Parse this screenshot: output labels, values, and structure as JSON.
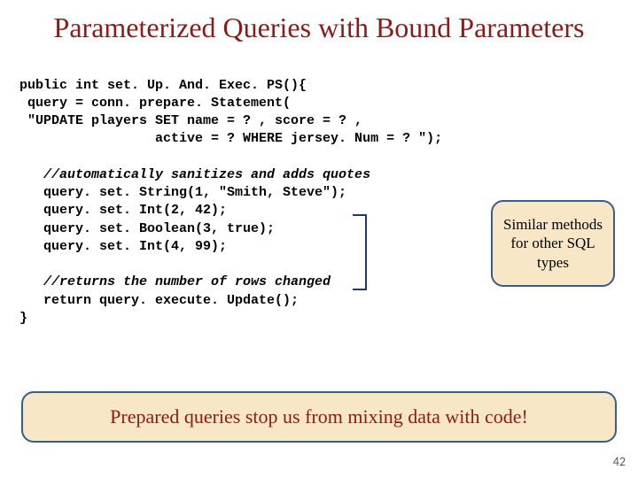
{
  "title": "Parameterized Queries with Bound Parameters",
  "code": {
    "l1": "public int set. Up. And. Exec. PS(){",
    "l2": " query = conn. prepare. Statement(",
    "l3": " \"UPDATE players SET name = ? , score = ? ,",
    "l4": "                 active = ? WHERE jersey. Num = ? \");",
    "l5": "",
    "c1": "   //automatically sanitizes and adds quotes",
    "l6": "   query. set. String(1, \"Smith, Steve\");",
    "l7": "   query. set. Int(2, 42);",
    "l8": "   query. set. Boolean(3, true);",
    "l9": "   query. set. Int(4, 99);",
    "l10": "",
    "c2": "   //returns the number of rows changed",
    "l11": "   return query. execute. Update();",
    "l12": "}"
  },
  "callout": "Similar methods for other SQL types",
  "summary": "Prepared queries stop us from mixing data with code!",
  "page": "42"
}
